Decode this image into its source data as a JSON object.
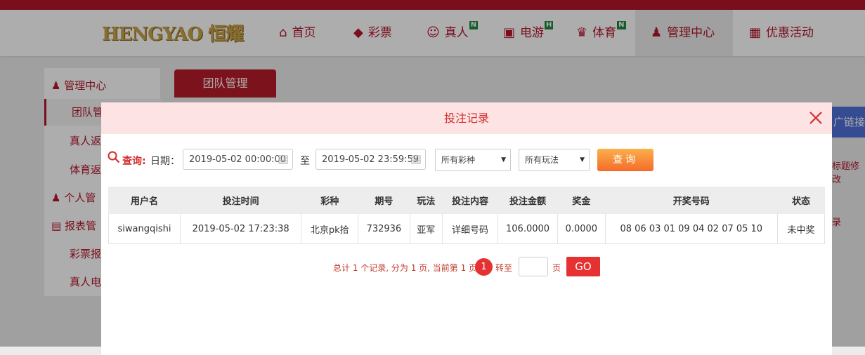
{
  "nav": {
    "logo_text": "HENGYAO 恒耀",
    "items": [
      {
        "label": "首页",
        "icon": "home-icon",
        "badge": ""
      },
      {
        "label": "彩票",
        "icon": "ticket-icon",
        "badge": ""
      },
      {
        "label": "真人",
        "icon": "person-icon",
        "badge": "N"
      },
      {
        "label": "电游",
        "icon": "gamepad-icon",
        "badge": "H"
      },
      {
        "label": "体育",
        "icon": "trophy-icon",
        "badge": "N"
      },
      {
        "label": "管理中心",
        "icon": "users-icon",
        "badge": ""
      },
      {
        "label": "优惠活动",
        "icon": "gift-icon",
        "badge": ""
      }
    ]
  },
  "sidebar": {
    "management_heading": "管理中心",
    "team_manage": "团队管",
    "live_rebate": "真人返",
    "sports_rebate": "体育返",
    "personal_heading": "个人管",
    "report_heading": "报表管",
    "lottery_report": "彩票报",
    "live_report": "真人电"
  },
  "content": {
    "tab_label": "团队管理",
    "right_link": "广链接",
    "right_text_1": "标题修改",
    "right_text_2": "录"
  },
  "modal": {
    "title": "投注记录",
    "query": {
      "label": "查询:",
      "date_label": "日期：",
      "start_date": "2019-05-02 00:00:00",
      "to_label": "至",
      "end_date": "2019-05-02 23:59:59",
      "lottery_select": "所有彩种",
      "play_select": "所有玩法",
      "submit_label": "查询"
    },
    "table": {
      "headers": [
        "用户名",
        "投注时间",
        "彩种",
        "期号",
        "玩法",
        "投注内容",
        "投注金额",
        "奖金",
        "开奖号码",
        "状态"
      ],
      "rows": [
        {
          "username": "siwangqishi",
          "bet_time": "2019-05-02 17:23:38",
          "lottery": "北京pk拾",
          "issue": "732936",
          "play": "亚军",
          "content": "详细号码",
          "amount": "106.0000",
          "prize": "0.0000",
          "draw_numbers": "08 06 03 01 09 04 02 07 05 10",
          "status": "未中奖"
        }
      ]
    },
    "pager": {
      "summary": "总计 1 个记录, 分为 1 页, 当前第 1 页",
      "current_page": "1",
      "goto_label": "转至",
      "page_unit": "页",
      "go_label": "GO"
    }
  },
  "colors": {
    "brand_red": "#b4162a",
    "accent_red": "#e53131",
    "modal_header_bg": "#fde3e3",
    "query_button": "#f46b2b",
    "detail_green": "#2f8f2f"
  }
}
